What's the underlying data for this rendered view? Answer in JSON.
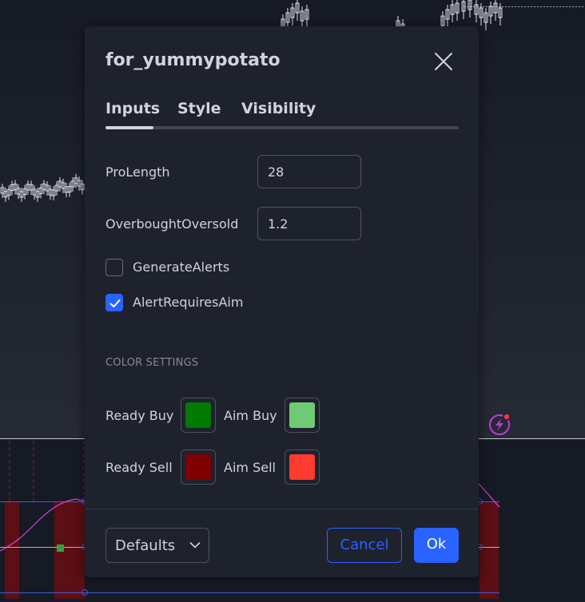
{
  "dialog": {
    "title": "for_yummypotato",
    "tabs": [
      {
        "label": "Inputs",
        "active": true
      },
      {
        "label": "Style",
        "active": false
      },
      {
        "label": "Visibility",
        "active": false
      }
    ],
    "inputs": {
      "pro_length": {
        "label": "ProLength",
        "value": "28"
      },
      "overbought_oversold": {
        "label": "OverboughtOversold",
        "value": "1.2"
      },
      "generate_alerts": {
        "label": "GenerateAlerts",
        "checked": false
      },
      "alert_requires_aim": {
        "label": "AlertRequiresAim",
        "checked": true
      }
    },
    "color_section": {
      "title": "COLOR SETTINGS",
      "ready_buy": {
        "label": "Ready Buy",
        "color": "#007a00"
      },
      "aim_buy": {
        "label": "Aim Buy",
        "color": "#6fcb73"
      },
      "ready_sell": {
        "label": "Ready Sell",
        "color": "#800000"
      },
      "aim_sell": {
        "label": "Aim Sell",
        "color": "#ff3b30"
      }
    },
    "footer": {
      "defaults_label": "Defaults",
      "cancel_label": "Cancel",
      "ok_label": "Ok"
    }
  },
  "theme": {
    "accent": "#2962ff",
    "background": "#1e222d",
    "text": "#d1d4dc"
  },
  "icons": [
    "close-icon",
    "check-icon",
    "chevron-down-icon",
    "alert-lightning-icon"
  ]
}
